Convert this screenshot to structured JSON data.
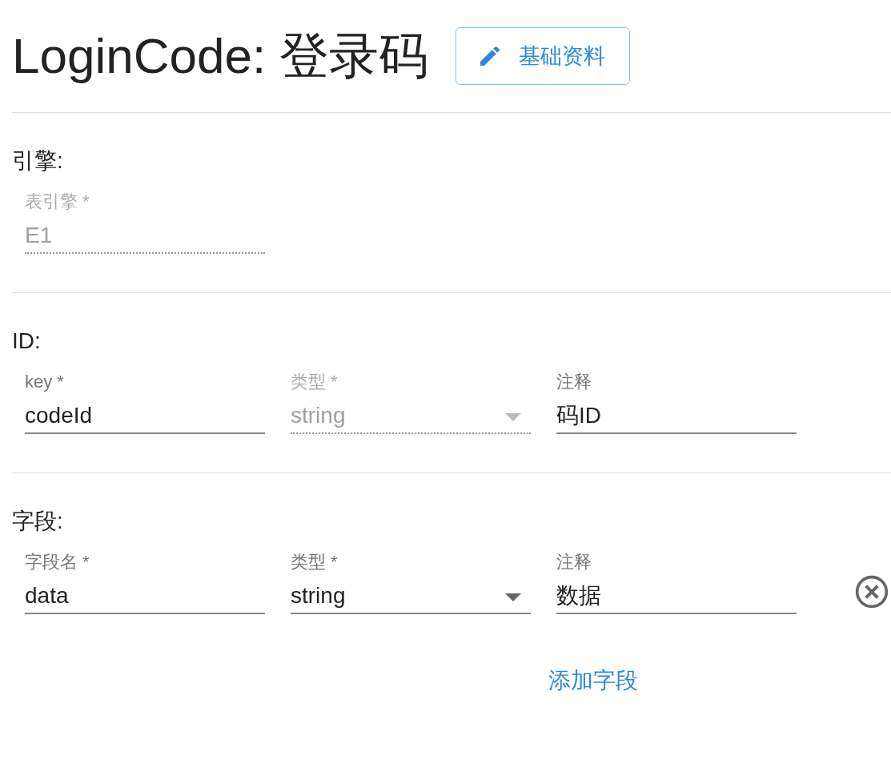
{
  "title": "LoginCode: 登录码",
  "edit_button": {
    "label": "基础资料"
  },
  "sections": [
    {
      "heading": "引擎:",
      "fields": [
        {
          "kind": "text",
          "label": "表引擎 *",
          "value": "E1",
          "disabled": true
        }
      ]
    },
    {
      "heading": "ID:",
      "fields": [
        {
          "kind": "text",
          "label": "key *",
          "value": "codeId",
          "disabled": false
        },
        {
          "kind": "select",
          "label": "类型 *",
          "value": "string",
          "disabled": true
        },
        {
          "kind": "text",
          "label": "注释",
          "value": "码ID",
          "disabled": false
        }
      ]
    },
    {
      "heading": "字段:",
      "fields": [
        {
          "kind": "text",
          "label": "字段名 *",
          "value": "data",
          "disabled": false
        },
        {
          "kind": "select",
          "label": "类型 *",
          "value": "string",
          "disabled": false
        },
        {
          "kind": "text",
          "label": "注释",
          "value": "数据",
          "disabled": false
        }
      ],
      "removable": true,
      "add_link": "添加字段"
    }
  ]
}
